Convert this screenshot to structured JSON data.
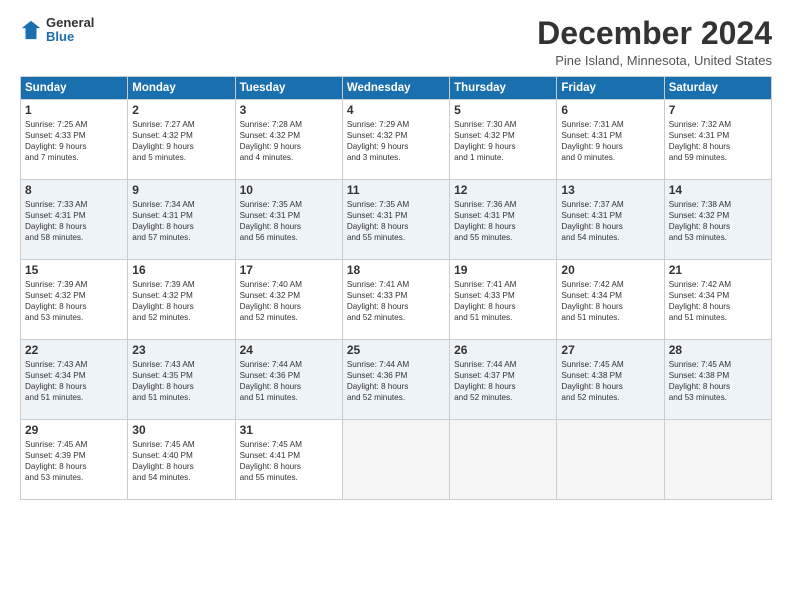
{
  "logo": {
    "general": "General",
    "blue": "Blue"
  },
  "title": "December 2024",
  "location": "Pine Island, Minnesota, United States",
  "days_of_week": [
    "Sunday",
    "Monday",
    "Tuesday",
    "Wednesday",
    "Thursday",
    "Friday",
    "Saturday"
  ],
  "weeks": [
    [
      {
        "day": "1",
        "lines": [
          "Sunrise: 7:25 AM",
          "Sunset: 4:33 PM",
          "Daylight: 9 hours",
          "and 7 minutes."
        ]
      },
      {
        "day": "2",
        "lines": [
          "Sunrise: 7:27 AM",
          "Sunset: 4:32 PM",
          "Daylight: 9 hours",
          "and 5 minutes."
        ]
      },
      {
        "day": "3",
        "lines": [
          "Sunrise: 7:28 AM",
          "Sunset: 4:32 PM",
          "Daylight: 9 hours",
          "and 4 minutes."
        ]
      },
      {
        "day": "4",
        "lines": [
          "Sunrise: 7:29 AM",
          "Sunset: 4:32 PM",
          "Daylight: 9 hours",
          "and 3 minutes."
        ]
      },
      {
        "day": "5",
        "lines": [
          "Sunrise: 7:30 AM",
          "Sunset: 4:32 PM",
          "Daylight: 9 hours",
          "and 1 minute."
        ]
      },
      {
        "day": "6",
        "lines": [
          "Sunrise: 7:31 AM",
          "Sunset: 4:31 PM",
          "Daylight: 9 hours",
          "and 0 minutes."
        ]
      },
      {
        "day": "7",
        "lines": [
          "Sunrise: 7:32 AM",
          "Sunset: 4:31 PM",
          "Daylight: 8 hours",
          "and 59 minutes."
        ]
      }
    ],
    [
      {
        "day": "8",
        "lines": [
          "Sunrise: 7:33 AM",
          "Sunset: 4:31 PM",
          "Daylight: 8 hours",
          "and 58 minutes."
        ]
      },
      {
        "day": "9",
        "lines": [
          "Sunrise: 7:34 AM",
          "Sunset: 4:31 PM",
          "Daylight: 8 hours",
          "and 57 minutes."
        ]
      },
      {
        "day": "10",
        "lines": [
          "Sunrise: 7:35 AM",
          "Sunset: 4:31 PM",
          "Daylight: 8 hours",
          "and 56 minutes."
        ]
      },
      {
        "day": "11",
        "lines": [
          "Sunrise: 7:35 AM",
          "Sunset: 4:31 PM",
          "Daylight: 8 hours",
          "and 55 minutes."
        ]
      },
      {
        "day": "12",
        "lines": [
          "Sunrise: 7:36 AM",
          "Sunset: 4:31 PM",
          "Daylight: 8 hours",
          "and 55 minutes."
        ]
      },
      {
        "day": "13",
        "lines": [
          "Sunrise: 7:37 AM",
          "Sunset: 4:31 PM",
          "Daylight: 8 hours",
          "and 54 minutes."
        ]
      },
      {
        "day": "14",
        "lines": [
          "Sunrise: 7:38 AM",
          "Sunset: 4:32 PM",
          "Daylight: 8 hours",
          "and 53 minutes."
        ]
      }
    ],
    [
      {
        "day": "15",
        "lines": [
          "Sunrise: 7:39 AM",
          "Sunset: 4:32 PM",
          "Daylight: 8 hours",
          "and 53 minutes."
        ]
      },
      {
        "day": "16",
        "lines": [
          "Sunrise: 7:39 AM",
          "Sunset: 4:32 PM",
          "Daylight: 8 hours",
          "and 52 minutes."
        ]
      },
      {
        "day": "17",
        "lines": [
          "Sunrise: 7:40 AM",
          "Sunset: 4:32 PM",
          "Daylight: 8 hours",
          "and 52 minutes."
        ]
      },
      {
        "day": "18",
        "lines": [
          "Sunrise: 7:41 AM",
          "Sunset: 4:33 PM",
          "Daylight: 8 hours",
          "and 52 minutes."
        ]
      },
      {
        "day": "19",
        "lines": [
          "Sunrise: 7:41 AM",
          "Sunset: 4:33 PM",
          "Daylight: 8 hours",
          "and 51 minutes."
        ]
      },
      {
        "day": "20",
        "lines": [
          "Sunrise: 7:42 AM",
          "Sunset: 4:34 PM",
          "Daylight: 8 hours",
          "and 51 minutes."
        ]
      },
      {
        "day": "21",
        "lines": [
          "Sunrise: 7:42 AM",
          "Sunset: 4:34 PM",
          "Daylight: 8 hours",
          "and 51 minutes."
        ]
      }
    ],
    [
      {
        "day": "22",
        "lines": [
          "Sunrise: 7:43 AM",
          "Sunset: 4:34 PM",
          "Daylight: 8 hours",
          "and 51 minutes."
        ]
      },
      {
        "day": "23",
        "lines": [
          "Sunrise: 7:43 AM",
          "Sunset: 4:35 PM",
          "Daylight: 8 hours",
          "and 51 minutes."
        ]
      },
      {
        "day": "24",
        "lines": [
          "Sunrise: 7:44 AM",
          "Sunset: 4:36 PM",
          "Daylight: 8 hours",
          "and 51 minutes."
        ]
      },
      {
        "day": "25",
        "lines": [
          "Sunrise: 7:44 AM",
          "Sunset: 4:36 PM",
          "Daylight: 8 hours",
          "and 52 minutes."
        ]
      },
      {
        "day": "26",
        "lines": [
          "Sunrise: 7:44 AM",
          "Sunset: 4:37 PM",
          "Daylight: 8 hours",
          "and 52 minutes."
        ]
      },
      {
        "day": "27",
        "lines": [
          "Sunrise: 7:45 AM",
          "Sunset: 4:38 PM",
          "Daylight: 8 hours",
          "and 52 minutes."
        ]
      },
      {
        "day": "28",
        "lines": [
          "Sunrise: 7:45 AM",
          "Sunset: 4:38 PM",
          "Daylight: 8 hours",
          "and 53 minutes."
        ]
      }
    ],
    [
      {
        "day": "29",
        "lines": [
          "Sunrise: 7:45 AM",
          "Sunset: 4:39 PM",
          "Daylight: 8 hours",
          "and 53 minutes."
        ]
      },
      {
        "day": "30",
        "lines": [
          "Sunrise: 7:45 AM",
          "Sunset: 4:40 PM",
          "Daylight: 8 hours",
          "and 54 minutes."
        ]
      },
      {
        "day": "31",
        "lines": [
          "Sunrise: 7:45 AM",
          "Sunset: 4:41 PM",
          "Daylight: 8 hours",
          "and 55 minutes."
        ]
      },
      null,
      null,
      null,
      null
    ]
  ]
}
